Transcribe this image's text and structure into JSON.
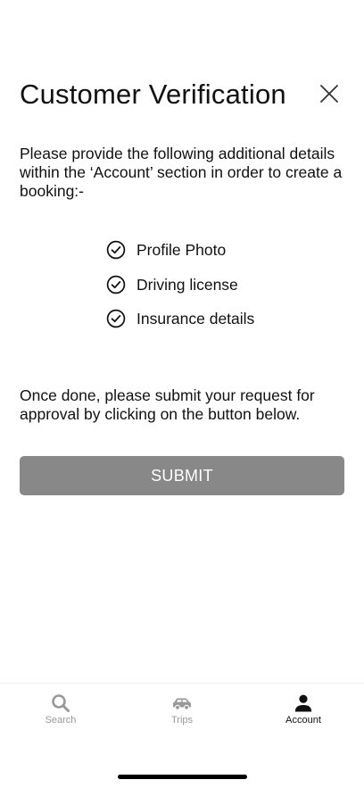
{
  "modal": {
    "title": "Customer Verification",
    "close_icon": "close-icon",
    "intro_text": "Please provide the following additional details within the ‘Account’ section in order to create a booking:-",
    "requirements": [
      {
        "label": "Profile Photo",
        "icon": "check-circle-icon"
      },
      {
        "label": "Driving license",
        "icon": "check-circle-icon"
      },
      {
        "label": "Insurance details",
        "icon": "check-circle-icon"
      }
    ],
    "outro_text": "Once done, please submit your request for approval by clicking on the button below.",
    "submit_label": "SUBMIT",
    "submit_color": "#888888"
  },
  "tabbar": {
    "tabs": [
      {
        "label": "Search",
        "icon": "search-icon",
        "active": false
      },
      {
        "label": "Trips",
        "icon": "car-icon",
        "active": false
      },
      {
        "label": "Account",
        "icon": "person-icon",
        "active": true
      }
    ],
    "active_color": "#111111",
    "inactive_color": "#999999"
  }
}
